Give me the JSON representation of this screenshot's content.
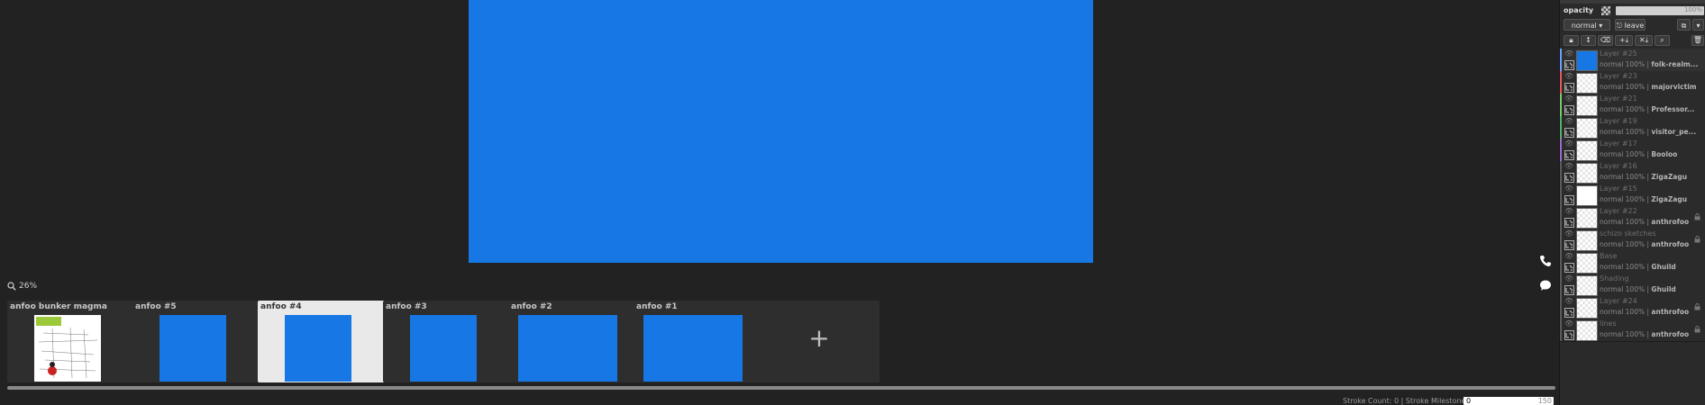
{
  "canvas": {
    "zoom": "26%",
    "color": "#1677e5"
  },
  "frames": [
    {
      "title": "anfoo bunker magma",
      "thumb": "sketch",
      "active": false
    },
    {
      "title": "anfoo #5",
      "thumb": "blue",
      "active": false
    },
    {
      "title": "anfoo #4",
      "thumb": "blue",
      "active": true
    },
    {
      "title": "anfoo #3",
      "thumb": "blue",
      "active": false
    },
    {
      "title": "anfoo #2",
      "thumb": "blue",
      "active": false
    },
    {
      "title": "anfoo #1",
      "thumb": "blue",
      "active": false
    }
  ],
  "frame_add_label": "+",
  "frame_menu_label": "⋮",
  "status": {
    "stroke_count": "Stroke Count: 0",
    "separator": "|",
    "stroke_milestone_label": "Stroke Milestone:",
    "milestone_value": "0",
    "milestone_max": "150"
  },
  "panel": {
    "opacity_label": "opacity",
    "opacity_value": "100%",
    "blend_mode": "normal ▾",
    "leave_label": "leave",
    "layers": [
      {
        "name": "Layer #25",
        "mode": "normal 100% |",
        "author": "folk-realm...",
        "thumb": "blue",
        "color": "#6aa0ff",
        "locked": false
      },
      {
        "name": "Layer #23",
        "mode": "normal 100% |",
        "author": "majorvictim",
        "thumb": "checker",
        "color": "#e05a5a",
        "locked": false
      },
      {
        "name": "Layer #21",
        "mode": "normal 100% |",
        "author": "Professor...",
        "thumb": "checker",
        "color": "#7ac96a",
        "locked": false
      },
      {
        "name": "Layer #19",
        "mode": "normal 100% |",
        "author": "visitor_pe...",
        "thumb": "checker",
        "color": "#4fb36a",
        "locked": false
      },
      {
        "name": "Layer #17",
        "mode": "normal 100% |",
        "author": "Booloo",
        "thumb": "checker",
        "color": "#9a6ad0",
        "locked": false
      },
      {
        "name": "Layer #16",
        "mode": "normal 100% |",
        "author": "ZigaZagu",
        "thumb": "checker",
        "color": "#5a5a5a",
        "locked": false
      },
      {
        "name": "Layer #15",
        "mode": "normal 100% |",
        "author": "ZigaZagu",
        "thumb": "white",
        "color": "#5a5a5a",
        "locked": false
      },
      {
        "name": "Layer #22",
        "mode": "normal 100% |",
        "author": "anthrofoo",
        "thumb": "checker",
        "color": "#5a5a5a",
        "locked": true
      },
      {
        "name": "schizo sketches",
        "mode": "normal 100% |",
        "author": "anthrofoo",
        "thumb": "checker",
        "color": "#5a5a5a",
        "locked": true
      },
      {
        "name": "Base",
        "mode": "normal 100% |",
        "author": "Ghuild",
        "thumb": "checker",
        "color": "#5a5a5a",
        "locked": false
      },
      {
        "name": "Shading",
        "mode": "normal 100% |",
        "author": "Ghuild",
        "thumb": "checker",
        "color": "#5a5a5a",
        "locked": false
      },
      {
        "name": "Layer #24",
        "mode": "normal 100% |",
        "author": "anthrofoo",
        "thumb": "checker",
        "color": "#5a5a5a",
        "locked": true
      },
      {
        "name": "lines",
        "mode": "normal 100% |",
        "author": "anthrofoo",
        "thumb": "checker",
        "color": "#5a5a5a",
        "locked": true
      }
    ]
  }
}
